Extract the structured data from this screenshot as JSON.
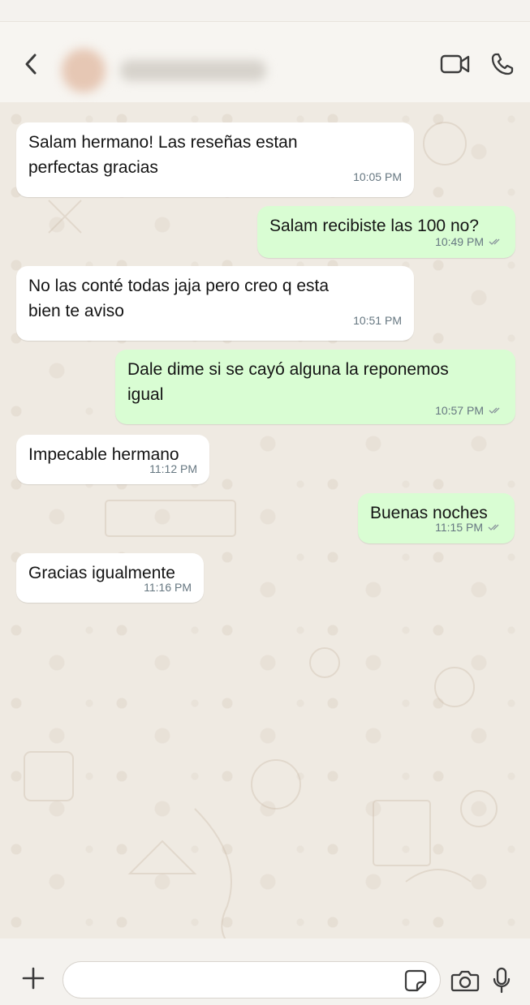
{
  "header": {
    "contact_name": "",
    "icons": {
      "back": "chevron-left-icon",
      "video": "video-camera-icon",
      "call": "phone-icon"
    }
  },
  "messages": [
    {
      "direction": "incoming",
      "lines": [
        "Salam hermano! Las reseñas estan",
        "perfectas gracias"
      ],
      "time": "10:05 PM"
    },
    {
      "direction": "outgoing",
      "lines": [
        "Salam recibiste las 100 no?"
      ],
      "time": "10:49 PM",
      "status": "read"
    },
    {
      "direction": "incoming",
      "lines": [
        "No las conté todas jaja pero creo q esta",
        "bien te aviso"
      ],
      "time": "10:51 PM"
    },
    {
      "direction": "outgoing",
      "lines": [
        "Dale dime si se cayó alguna la reponemos",
        "igual"
      ],
      "time": "10:57 PM",
      "status": "read"
    },
    {
      "direction": "incoming",
      "lines": [
        "Impecable hermano"
      ],
      "time": "11:12 PM"
    },
    {
      "direction": "outgoing",
      "lines": [
        "Buenas noches"
      ],
      "time": "11:15 PM",
      "status": "read"
    },
    {
      "direction": "incoming",
      "lines": [
        "Gracias igualmente"
      ],
      "time": "11:16 PM"
    }
  ],
  "composer": {
    "placeholder": "",
    "icons": {
      "add": "plus-icon",
      "sticker": "sticker-icon",
      "camera": "camera-icon",
      "mic": "microphone-icon"
    }
  },
  "colors": {
    "incoming_bubble": "#ffffff",
    "outgoing_bubble": "#d9fdd3",
    "chat_background": "#efeae2",
    "meta_text": "#667781"
  }
}
